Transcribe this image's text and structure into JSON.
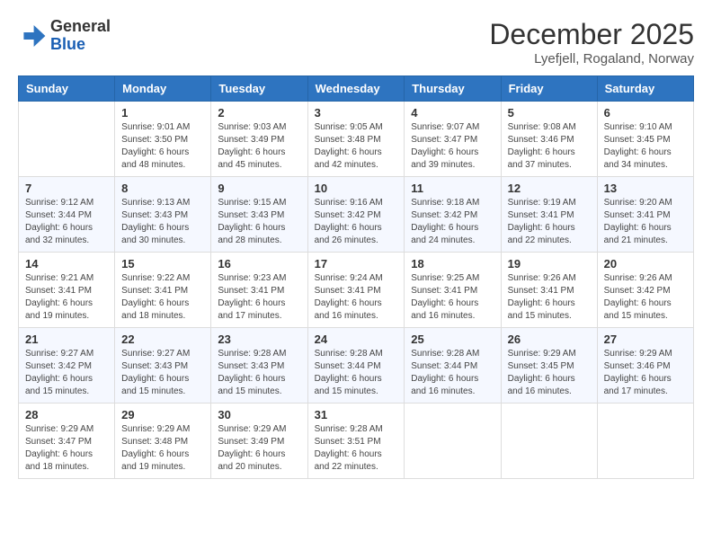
{
  "logo": {
    "general": "General",
    "blue": "Blue"
  },
  "title": "December 2025",
  "location": "Lyefjell, Rogaland, Norway",
  "days_of_week": [
    "Sunday",
    "Monday",
    "Tuesday",
    "Wednesday",
    "Thursday",
    "Friday",
    "Saturday"
  ],
  "weeks": [
    [
      {
        "num": "",
        "info": ""
      },
      {
        "num": "1",
        "info": "Sunrise: 9:01 AM\nSunset: 3:50 PM\nDaylight: 6 hours\nand 48 minutes."
      },
      {
        "num": "2",
        "info": "Sunrise: 9:03 AM\nSunset: 3:49 PM\nDaylight: 6 hours\nand 45 minutes."
      },
      {
        "num": "3",
        "info": "Sunrise: 9:05 AM\nSunset: 3:48 PM\nDaylight: 6 hours\nand 42 minutes."
      },
      {
        "num": "4",
        "info": "Sunrise: 9:07 AM\nSunset: 3:47 PM\nDaylight: 6 hours\nand 39 minutes."
      },
      {
        "num": "5",
        "info": "Sunrise: 9:08 AM\nSunset: 3:46 PM\nDaylight: 6 hours\nand 37 minutes."
      },
      {
        "num": "6",
        "info": "Sunrise: 9:10 AM\nSunset: 3:45 PM\nDaylight: 6 hours\nand 34 minutes."
      }
    ],
    [
      {
        "num": "7",
        "info": "Sunrise: 9:12 AM\nSunset: 3:44 PM\nDaylight: 6 hours\nand 32 minutes."
      },
      {
        "num": "8",
        "info": "Sunrise: 9:13 AM\nSunset: 3:43 PM\nDaylight: 6 hours\nand 30 minutes."
      },
      {
        "num": "9",
        "info": "Sunrise: 9:15 AM\nSunset: 3:43 PM\nDaylight: 6 hours\nand 28 minutes."
      },
      {
        "num": "10",
        "info": "Sunrise: 9:16 AM\nSunset: 3:42 PM\nDaylight: 6 hours\nand 26 minutes."
      },
      {
        "num": "11",
        "info": "Sunrise: 9:18 AM\nSunset: 3:42 PM\nDaylight: 6 hours\nand 24 minutes."
      },
      {
        "num": "12",
        "info": "Sunrise: 9:19 AM\nSunset: 3:41 PM\nDaylight: 6 hours\nand 22 minutes."
      },
      {
        "num": "13",
        "info": "Sunrise: 9:20 AM\nSunset: 3:41 PM\nDaylight: 6 hours\nand 21 minutes."
      }
    ],
    [
      {
        "num": "14",
        "info": "Sunrise: 9:21 AM\nSunset: 3:41 PM\nDaylight: 6 hours\nand 19 minutes."
      },
      {
        "num": "15",
        "info": "Sunrise: 9:22 AM\nSunset: 3:41 PM\nDaylight: 6 hours\nand 18 minutes."
      },
      {
        "num": "16",
        "info": "Sunrise: 9:23 AM\nSunset: 3:41 PM\nDaylight: 6 hours\nand 17 minutes."
      },
      {
        "num": "17",
        "info": "Sunrise: 9:24 AM\nSunset: 3:41 PM\nDaylight: 6 hours\nand 16 minutes."
      },
      {
        "num": "18",
        "info": "Sunrise: 9:25 AM\nSunset: 3:41 PM\nDaylight: 6 hours\nand 16 minutes."
      },
      {
        "num": "19",
        "info": "Sunrise: 9:26 AM\nSunset: 3:41 PM\nDaylight: 6 hours\nand 15 minutes."
      },
      {
        "num": "20",
        "info": "Sunrise: 9:26 AM\nSunset: 3:42 PM\nDaylight: 6 hours\nand 15 minutes."
      }
    ],
    [
      {
        "num": "21",
        "info": "Sunrise: 9:27 AM\nSunset: 3:42 PM\nDaylight: 6 hours\nand 15 minutes."
      },
      {
        "num": "22",
        "info": "Sunrise: 9:27 AM\nSunset: 3:43 PM\nDaylight: 6 hours\nand 15 minutes."
      },
      {
        "num": "23",
        "info": "Sunrise: 9:28 AM\nSunset: 3:43 PM\nDaylight: 6 hours\nand 15 minutes."
      },
      {
        "num": "24",
        "info": "Sunrise: 9:28 AM\nSunset: 3:44 PM\nDaylight: 6 hours\nand 15 minutes."
      },
      {
        "num": "25",
        "info": "Sunrise: 9:28 AM\nSunset: 3:44 PM\nDaylight: 6 hours\nand 16 minutes."
      },
      {
        "num": "26",
        "info": "Sunrise: 9:29 AM\nSunset: 3:45 PM\nDaylight: 6 hours\nand 16 minutes."
      },
      {
        "num": "27",
        "info": "Sunrise: 9:29 AM\nSunset: 3:46 PM\nDaylight: 6 hours\nand 17 minutes."
      }
    ],
    [
      {
        "num": "28",
        "info": "Sunrise: 9:29 AM\nSunset: 3:47 PM\nDaylight: 6 hours\nand 18 minutes."
      },
      {
        "num": "29",
        "info": "Sunrise: 9:29 AM\nSunset: 3:48 PM\nDaylight: 6 hours\nand 19 minutes."
      },
      {
        "num": "30",
        "info": "Sunrise: 9:29 AM\nSunset: 3:49 PM\nDaylight: 6 hours\nand 20 minutes."
      },
      {
        "num": "31",
        "info": "Sunrise: 9:28 AM\nSunset: 3:51 PM\nDaylight: 6 hours\nand 22 minutes."
      },
      {
        "num": "",
        "info": ""
      },
      {
        "num": "",
        "info": ""
      },
      {
        "num": "",
        "info": ""
      }
    ]
  ]
}
